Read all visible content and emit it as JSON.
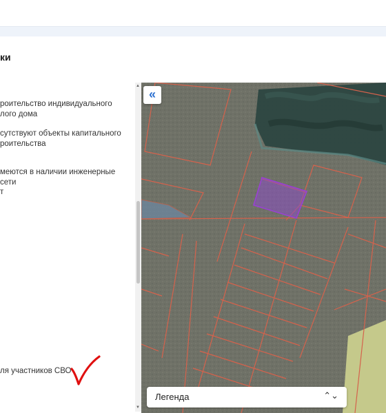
{
  "header": {
    "section_title": "ки"
  },
  "properties": [
    "роительство индивидуального",
    "лого дома",
    "сутствуют объекты капитального",
    "роительства",
    "меются в наличии инженерные сети",
    "т",
    "ля участников СВО"
  ],
  "map": {
    "collapse_button": "«",
    "legend": {
      "label": "Легенда",
      "chevron": "⌃⌄"
    }
  },
  "colors": {
    "parcel_border": "#d5624c",
    "highlight_parcel": "#9b3fd6",
    "forest": "#27423b",
    "field": "#c2c88a",
    "annotation_mark": "#e01010"
  }
}
